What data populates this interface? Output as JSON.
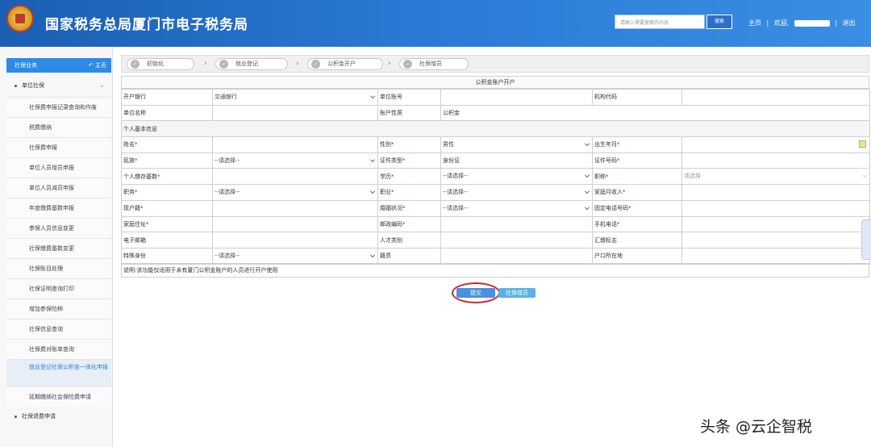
{
  "header": {
    "title": "国家税务总局厦门市电子税务局",
    "search_placeholder": "请输入需要搜索的内容",
    "search_button": "搜索",
    "home": "主页",
    "welcome": "欢迎,",
    "separator": "|",
    "logout": "退出"
  },
  "sidebar": {
    "head": "社保业务",
    "home": "主页",
    "group1": "单位社保",
    "items": [
      "社保费申报记录查询和作废",
      "税费缴纳",
      "社保费申报",
      "单位人员增员申报",
      "单位人员减员申报",
      "年度缴费基数申报",
      "参保人员信息变更",
      "社保缴费基数变更",
      "社保账目处理",
      "社保证明查询打印",
      "增加参保险种",
      "社保信息查询",
      "社保费对账单查询",
      "就业登记社保公积金一体化申报",
      "延期缴纳社会保险费申请"
    ],
    "group2": "社保退费申请"
  },
  "steps": [
    {
      "label": "初始化"
    },
    {
      "label": "就业登记"
    },
    {
      "label": "公积金开户"
    },
    {
      "label": "社保增员"
    }
  ],
  "form": {
    "title": "公积金账户开户",
    "open_bank_label": "开户银行",
    "open_bank_value": "交通银行",
    "unit_account_label": "单位账号",
    "org_code_label": "机构代码",
    "unit_name_label": "单位名称",
    "account_type_label": "账户性质",
    "account_type_value": "公积金",
    "personal_section": "个人基本信息",
    "name_label": "姓名",
    "gender_label": "性别",
    "gender_value": "男性",
    "birth_label": "出生年月",
    "nation_label": "民族",
    "please_select": "--请选择--",
    "cert_type_label": "证件类型",
    "cert_type_value": "身份证",
    "cert_no_label": "证件号码",
    "deposit_base_label": "个人缴存基数",
    "education_label": "学历",
    "title_label": "职称",
    "title_placeholder": "请选择",
    "duty_label": "职务",
    "occupation_label": "职业",
    "income_label": "家庭月收入",
    "hukou_label": "现户籍",
    "marital_label": "婚姻状况",
    "phone_label": "固定电话号码",
    "address_label": "家庭住址",
    "postcode_label": "邮政编码",
    "mobile_label": "手机电话",
    "email_label": "电子邮箱",
    "talent_label": "人才类别",
    "sum_flag_label": "汇缴标志",
    "special_label": "特殊身份",
    "origin_label": "籍贯",
    "registered_label": "户口所在地",
    "note": "说明:该功能仅适用于未有厦门公积金账户的人员进行开户使用"
  },
  "buttons": {
    "submit": "提交",
    "next": "社保增员"
  },
  "watermark": "头条 @云企智税"
}
